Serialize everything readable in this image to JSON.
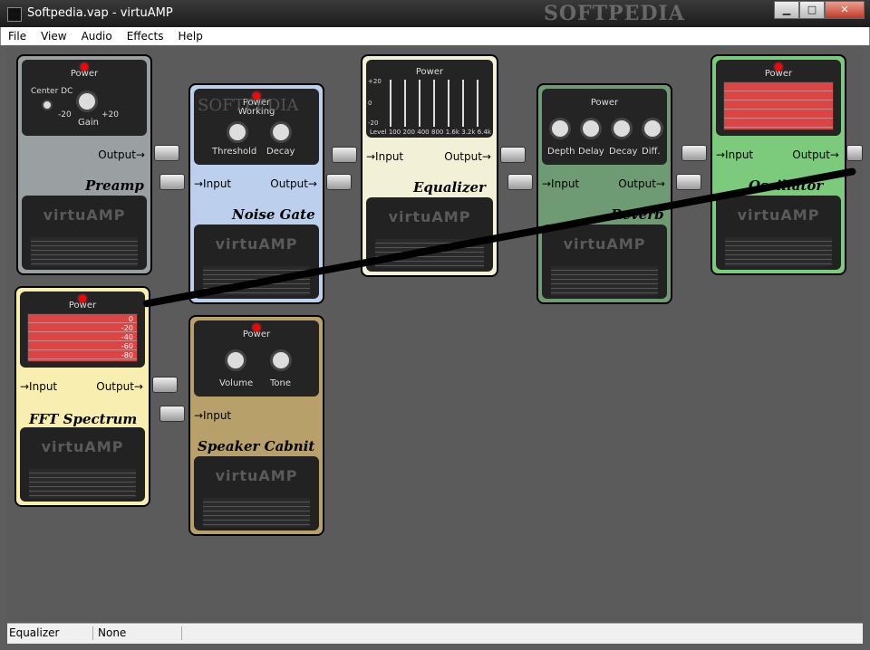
{
  "window": {
    "title": "Softpedia.vap - virtuAMP",
    "watermark": "SOFTPEDIA"
  },
  "menu": [
    "File",
    "View",
    "Audio",
    "Effects",
    "Help"
  ],
  "status": {
    "cell1": "Equalizer",
    "cell2": "None"
  },
  "labels": {
    "power": "Power",
    "input": "→Input",
    "output": "Output→",
    "brand": "virtuAMP"
  },
  "pedals": {
    "preamp": {
      "name": "Preamp",
      "gain": "Gain",
      "center": "Center DC",
      "neg": "-20",
      "pos": "+20"
    },
    "noisegate": {
      "name": "Noise Gate",
      "working": "Working",
      "threshold": "Threshold",
      "decay": "Decay",
      "wm": "SOFTPEDIA"
    },
    "equalizer": {
      "name": "Equalizer",
      "bands": [
        "Level",
        "100",
        "200",
        "400",
        "800",
        "1.6k",
        "3.2k",
        "6.4k"
      ],
      "scale": [
        "+20",
        "0",
        "-20"
      ]
    },
    "reverb": {
      "name": "Reverb",
      "knobs": [
        "Depth",
        "Delay",
        "Decay",
        "Diff."
      ]
    },
    "oscillator": {
      "name": "Oscillator"
    },
    "fft": {
      "name": "FFT Spectrum",
      "scale": [
        "0",
        "-20",
        "-40",
        "-60",
        "-80"
      ]
    },
    "speaker": {
      "name": "Speaker Cabnit",
      "volume": "Volume",
      "tone": "Tone"
    }
  },
  "colors": {
    "preamp": "#9aa0a2",
    "noisegate": "#bcd0ee",
    "equalizer": "#f3f0d8",
    "reverb": "#6e9a74",
    "oscillator": "#7ccb7c",
    "fft": "#f7eeb0",
    "speaker": "#b8a06a"
  }
}
